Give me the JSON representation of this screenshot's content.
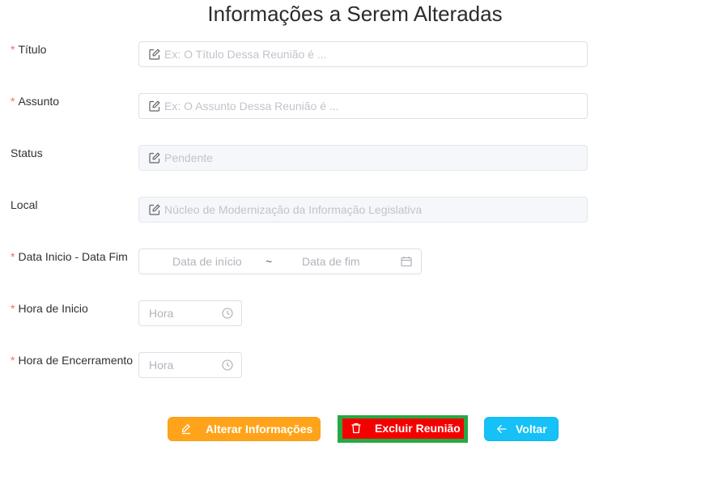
{
  "page": {
    "title": "Informações a Serem Alteradas"
  },
  "form": {
    "required_mark": "*",
    "titulo": {
      "label": "Título",
      "placeholder": "Ex: O Título Dessa Reunião é ..."
    },
    "assunto": {
      "label": "Assunto",
      "placeholder": "Ex: O Assunto Dessa Reunião é ..."
    },
    "status": {
      "label": "Status",
      "value": "Pendente"
    },
    "local": {
      "label": "Local",
      "value": "Núcleo de Modernização da Informação Legislativa"
    },
    "data": {
      "label": "Data Inicio - Data Fim",
      "start_placeholder": "Data de início",
      "separator": "~",
      "end_placeholder": "Data de fim"
    },
    "hora_inicio": {
      "label": "Hora de Inicio",
      "placeholder": "Hora"
    },
    "hora_fim": {
      "label": "Hora de Encerramento",
      "placeholder": "Hora"
    }
  },
  "actions": {
    "alter": {
      "label": "Alterar Informações",
      "icon": "edit-icon",
      "color": "#ffa41a"
    },
    "delete": {
      "label": "Excluir Reunião",
      "icon": "trash-icon",
      "color": "#f40000",
      "highlight": "#27a844"
    },
    "back": {
      "label": "Voltar",
      "icon": "arrow-left-icon",
      "color": "#15c1f7"
    }
  }
}
